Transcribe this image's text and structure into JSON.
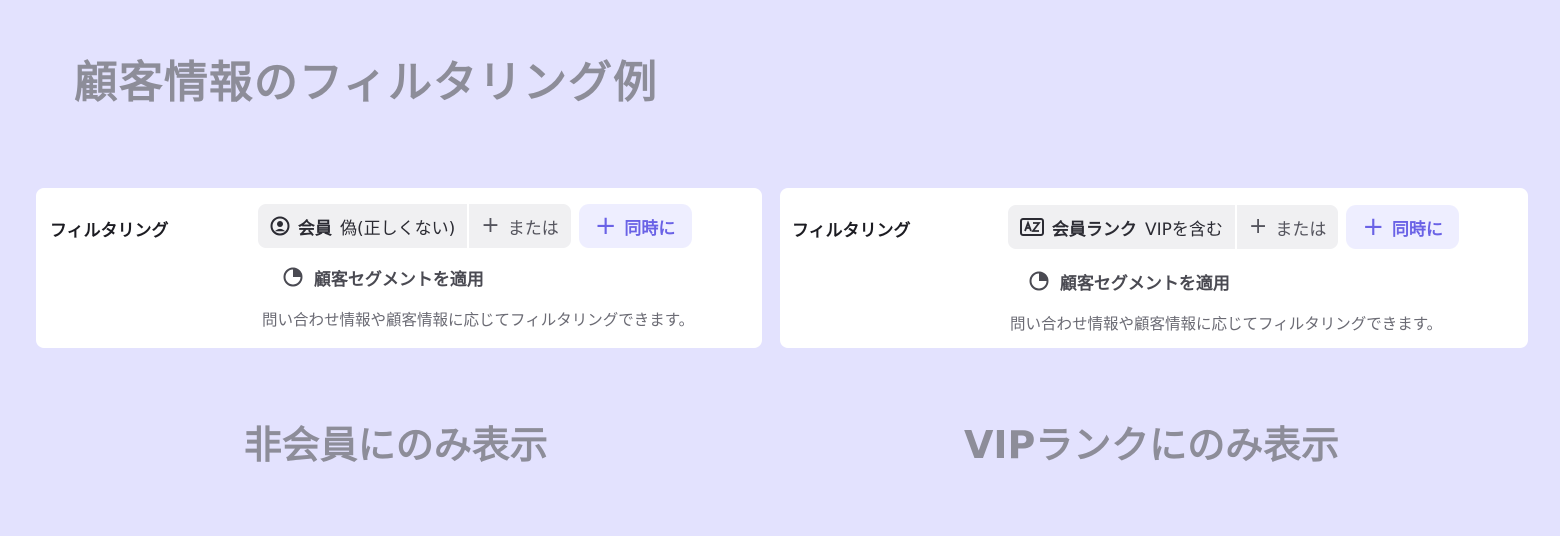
{
  "page": {
    "title": "顧客情報のフィルタリング例"
  },
  "cards": [
    {
      "label": "フィルタリング",
      "condition_field": "会員",
      "condition_value": "偽(正しくない)",
      "or_label": "または",
      "and_label": "同時に",
      "segment_label": "顧客セグメントを適用",
      "help_text": "問い合わせ情報や顧客情報に応じてフィルタリングできます。",
      "caption": "非会員にのみ表示",
      "field_icon": "user-circle-icon"
    },
    {
      "label": "フィルタリング",
      "condition_field": "会員ランク",
      "condition_value": "VIPを含む",
      "or_label": "または",
      "and_label": "同時に",
      "segment_label": "顧客セグメントを適用",
      "help_text": "問い合わせ情報や顧客情報に応じてフィルタリングできます。",
      "caption": "VIPランクにのみ表示",
      "field_icon": "az-text-icon"
    }
  ],
  "colors": {
    "background": "#e3e2fe",
    "accent": "#6a62e6",
    "muted_title": "#8d8d99"
  }
}
